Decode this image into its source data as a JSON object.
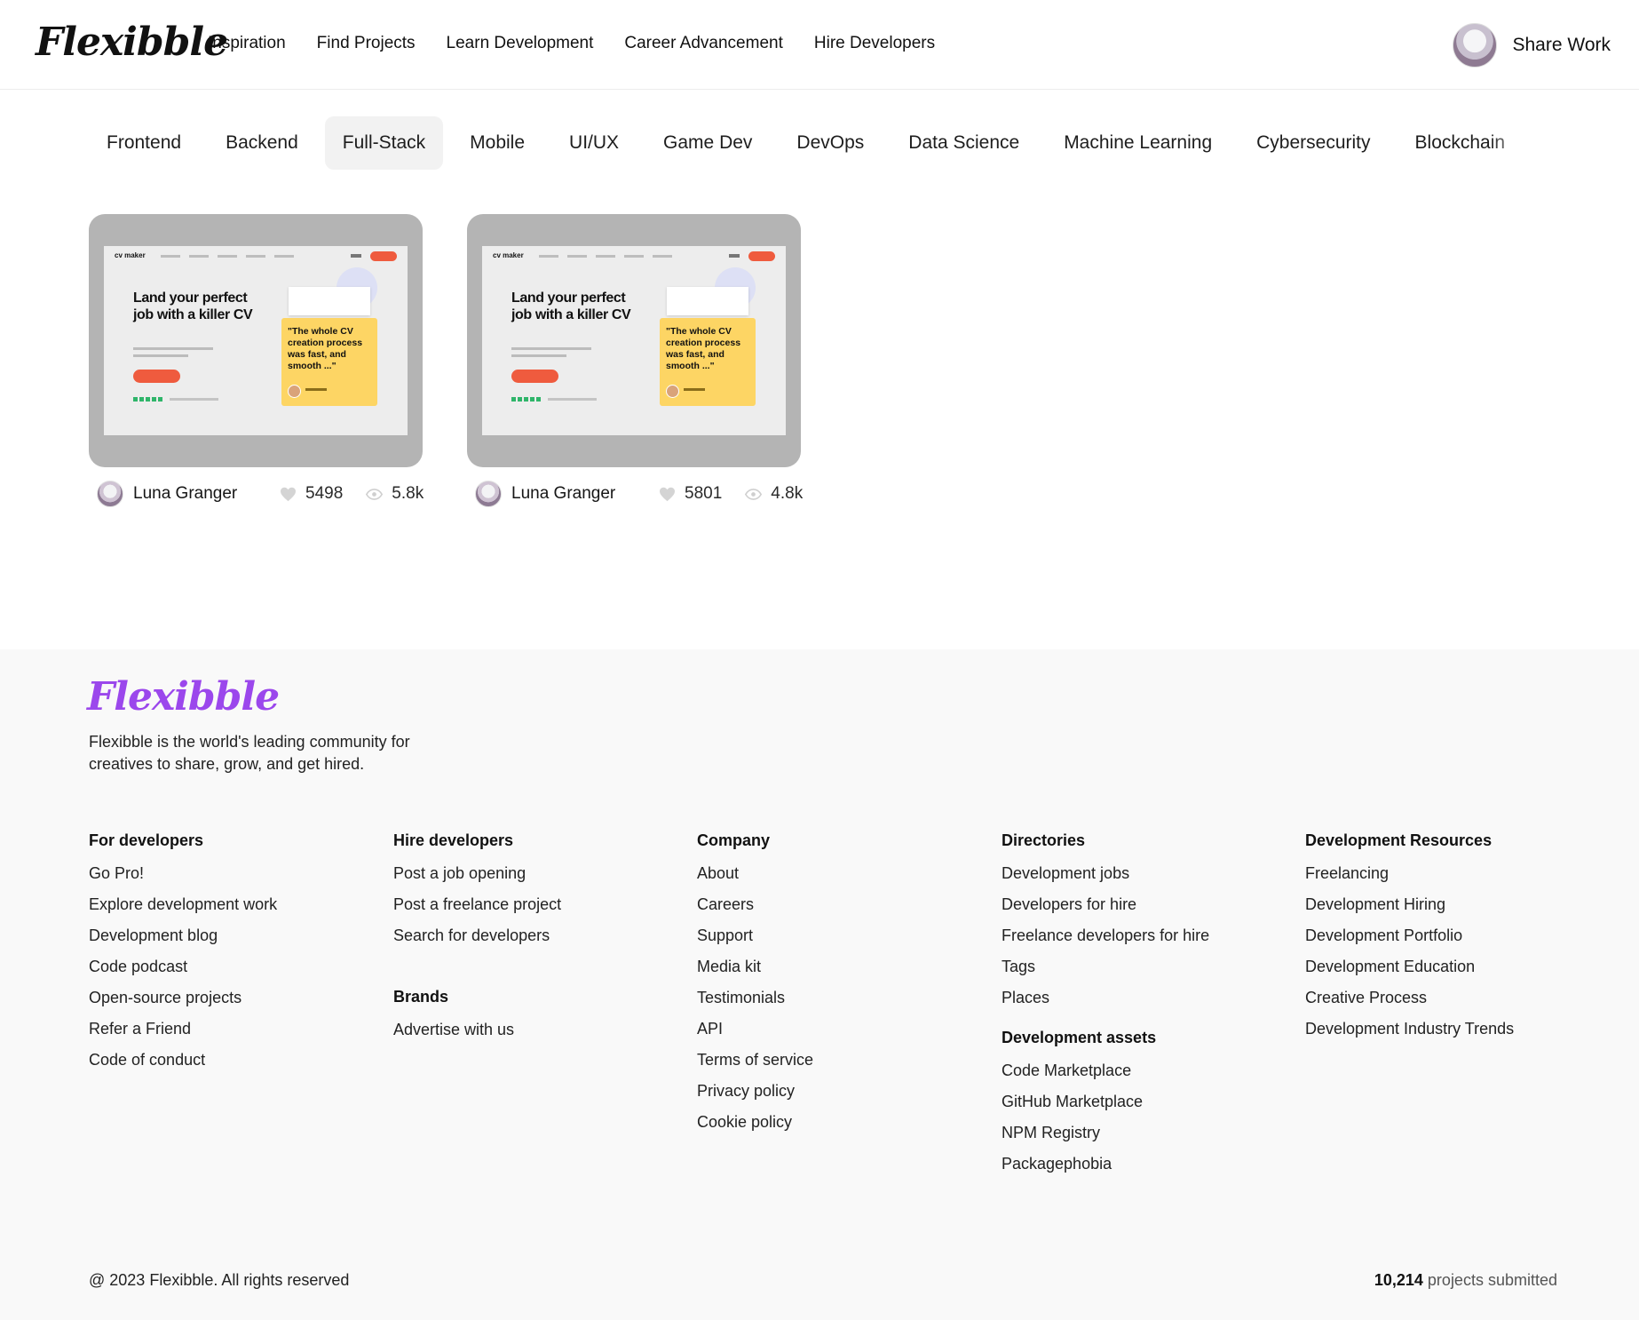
{
  "header": {
    "logo": "Flexibble",
    "nav": [
      "Inspiration",
      "Find Projects",
      "Learn Development",
      "Career Advancement",
      "Hire Developers"
    ],
    "share_label": "Share Work"
  },
  "categories": {
    "items": [
      "Frontend",
      "Backend",
      "Full-Stack",
      "Mobile",
      "UI/UX",
      "Game Dev",
      "DevOps",
      "Data Science",
      "Machine Learning",
      "Cybersecurity",
      "Blockchain"
    ],
    "active": "Full-Stack"
  },
  "projects": [
    {
      "brand": "cv maker",
      "headline": "Land your perfect job with a killer CV",
      "quote": "\"The whole CV creation process was fast, and smooth ...\"",
      "author": "Luna Granger",
      "likes": "5498",
      "views": "5.8k"
    },
    {
      "brand": "cv maker",
      "headline": "Land your perfect job with a killer CV",
      "quote": "\"The whole CV creation process was fast, and smooth ...\"",
      "author": "Luna Granger",
      "likes": "5801",
      "views": "4.8k"
    }
  ],
  "footer": {
    "logo": "Flexibble",
    "description": "Flexibble is the world's leading community for creatives to share, grow, and get hired.",
    "columns": {
      "developers": {
        "title": "For developers",
        "links": [
          "Go Pro!",
          "Explore development work",
          "Development blog",
          "Code podcast",
          "Open-source projects",
          "Refer a Friend",
          "Code of conduct"
        ]
      },
      "hire": {
        "title": "Hire developers",
        "links": [
          "Post a job opening",
          "Post a freelance project",
          "Search for developers"
        ]
      },
      "brands": {
        "title": "Brands",
        "links": [
          "Advertise with us"
        ]
      },
      "company": {
        "title": "Company",
        "links": [
          "About",
          "Careers",
          "Support",
          "Media kit",
          "Testimonials",
          "API",
          "Terms of service",
          "Privacy policy",
          "Cookie policy"
        ]
      },
      "directories": {
        "title": "Directories",
        "links": [
          "Development jobs",
          "Developers for hire",
          "Freelance developers for hire",
          "Tags",
          "Places"
        ]
      },
      "assets": {
        "title": "Development assets",
        "links": [
          "Code Marketplace",
          "GitHub Marketplace",
          "NPM Registry",
          "Packagephobia"
        ]
      },
      "resources": {
        "title": "Development Resources",
        "links": [
          "Freelancing",
          "Development Hiring",
          "Development Portfolio",
          "Development Education",
          "Creative Process",
          "Development Industry Trends"
        ]
      }
    },
    "copyright": "@ 2023 Flexibble. All rights reserved",
    "projects_count": "10,214",
    "projects_label": "projects submitted"
  },
  "colors": {
    "accent_purple": "#9b47ec",
    "tab_active_bg": "#f2f2f2",
    "thumb_bg": "#b4b4b4",
    "cta_red": "#ef5b3e",
    "quote_yellow": "#fdd564",
    "footer_bg": "#f9f9f9"
  },
  "icons": [
    "avatar",
    "heart-icon",
    "eye-icon"
  ]
}
